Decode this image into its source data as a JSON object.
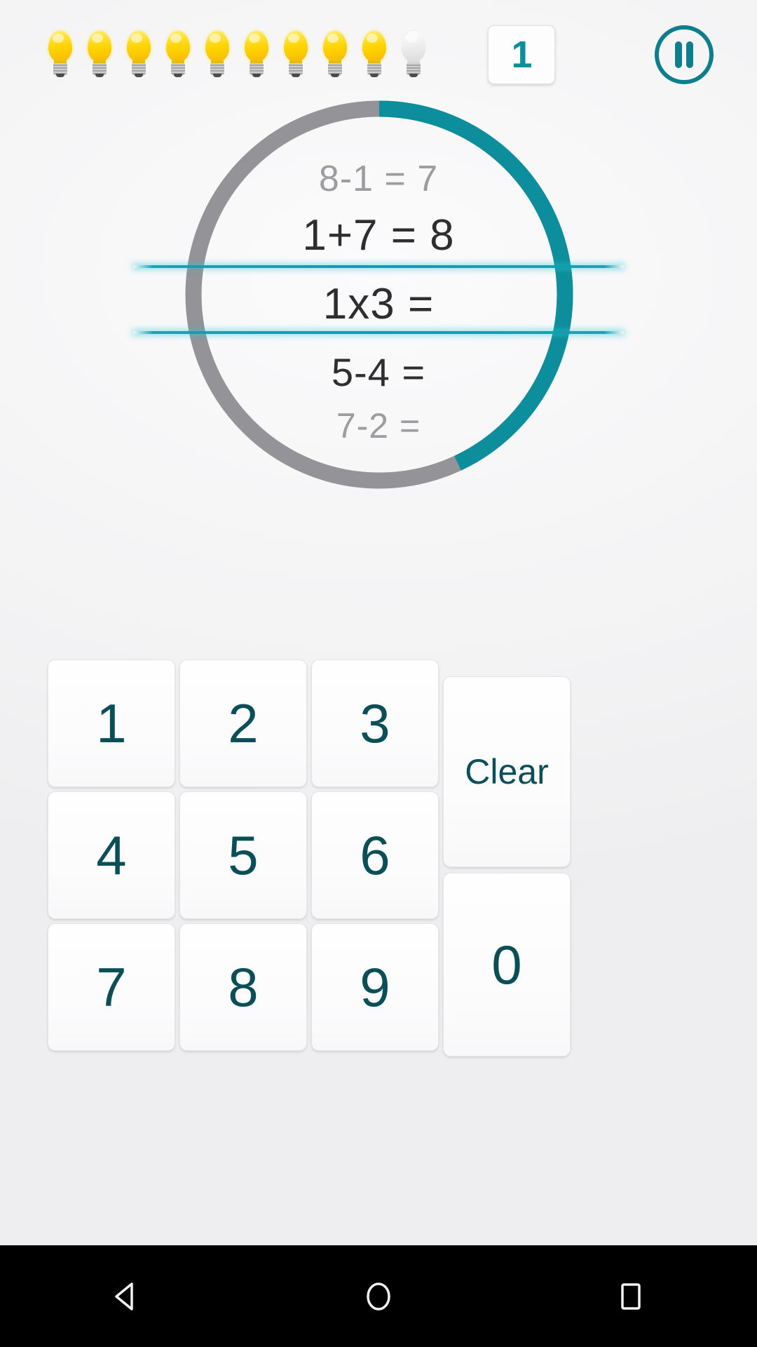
{
  "app": {
    "accent_teal": "#0d8e9c",
    "key_text_color": "#0a4f58",
    "ring_track_color": "#939398",
    "ring_progress_color": "#0d8e9c"
  },
  "top_bar": {
    "lives_icon_name": "lightbulb-icon",
    "lives_total": 10,
    "lives_remaining": 9,
    "lives": [
      {
        "state": "on"
      },
      {
        "state": "on"
      },
      {
        "state": "on"
      },
      {
        "state": "on"
      },
      {
        "state": "on"
      },
      {
        "state": "on"
      },
      {
        "state": "on"
      },
      {
        "state": "on"
      },
      {
        "state": "on"
      },
      {
        "state": "off"
      }
    ],
    "score_value": "1",
    "pause_icon_name": "pause-icon"
  },
  "ring": {
    "progress_percent": 43,
    "progress_degrees": 155,
    "track_color": "#939398",
    "progress_color": "#0d8e9c"
  },
  "equations": {
    "past_1": "8-1 = 7",
    "past_2": "1+7 = 8",
    "current": "1x3 =",
    "next_1": "5-4 =",
    "next_2": "7-2 ="
  },
  "keypad": {
    "keys": [
      {
        "label": "1",
        "type": "digit"
      },
      {
        "label": "2",
        "type": "digit"
      },
      {
        "label": "3",
        "type": "digit"
      },
      {
        "label": "4",
        "type": "digit"
      },
      {
        "label": "5",
        "type": "digit"
      },
      {
        "label": "6",
        "type": "digit"
      },
      {
        "label": "7",
        "type": "digit"
      },
      {
        "label": "8",
        "type": "digit"
      },
      {
        "label": "9",
        "type": "digit"
      },
      {
        "label": "0",
        "type": "digit"
      }
    ],
    "clear_label": "Clear",
    "zero_label": "0"
  },
  "nav_bar": {
    "back_icon_name": "back-triangle-icon",
    "home_icon_name": "home-circle-icon",
    "recents_icon_name": "recents-square-icon"
  }
}
